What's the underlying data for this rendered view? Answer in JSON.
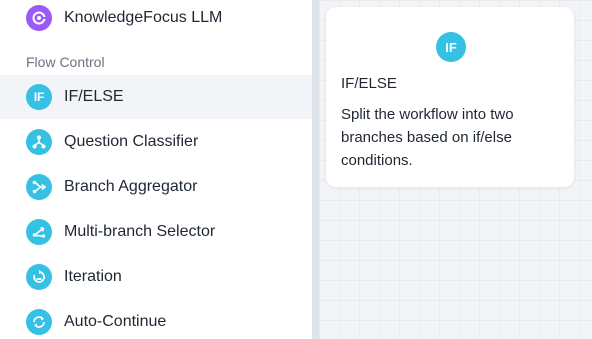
{
  "sidebar": {
    "items": [
      {
        "label": "KnowledgeFocus LLM",
        "icon": "llm-icon",
        "color": "#9b59f6"
      },
      {
        "label": "IF/ELSE",
        "icon": "if-icon",
        "icon_text": "IF",
        "color": "#35c1e4"
      },
      {
        "label": "Question Classifier",
        "icon": "classifier-icon",
        "color": "#35c1e4"
      },
      {
        "label": "Branch Aggregator",
        "icon": "aggregator-icon",
        "color": "#35c1e4"
      },
      {
        "label": "Multi-branch Selector",
        "icon": "selector-icon",
        "color": "#35c1e4"
      },
      {
        "label": "Iteration",
        "icon": "iteration-icon",
        "color": "#35c1e4"
      },
      {
        "label": "Auto-Continue",
        "icon": "auto-continue-icon",
        "color": "#35c1e4"
      }
    ],
    "section_title": "Flow Control"
  },
  "card": {
    "icon_text": "IF",
    "title": "IF/ELSE",
    "description": "Split the workflow into two branches based on if/else conditions."
  }
}
